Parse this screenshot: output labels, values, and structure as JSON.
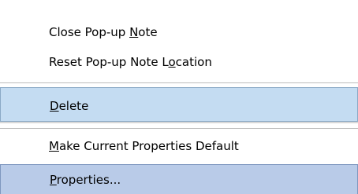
{
  "menu": {
    "items": [
      {
        "before": "Close Pop-up ",
        "mnemonic": "N",
        "after": "ote"
      },
      {
        "before": "Reset Pop-up Note L",
        "mnemonic": "o",
        "after": "cation"
      },
      {
        "before": "",
        "mnemonic": "D",
        "after": "elete"
      },
      {
        "before": "",
        "mnemonic": "M",
        "after": "ake Current Properties Default"
      },
      {
        "before": "",
        "mnemonic": "P",
        "after": "roperties..."
      }
    ]
  },
  "colors": {
    "delete_highlight": "#c4dcf2",
    "properties_highlight": "#b9cbe8"
  }
}
